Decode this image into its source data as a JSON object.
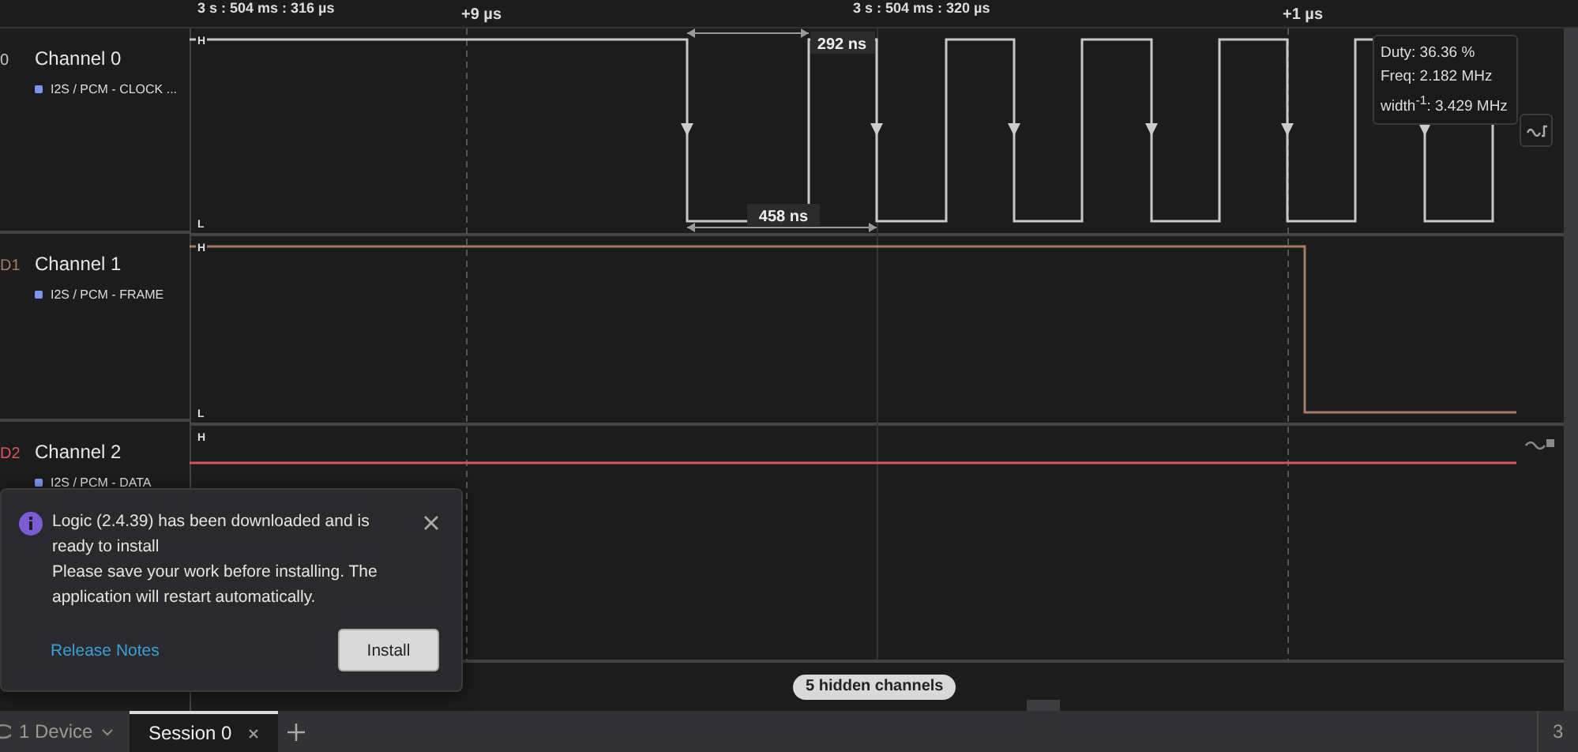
{
  "ruler": {
    "timestamps": [
      "3 s : 504 ms : 316 µs",
      "3 s : 504 ms : 320 µs"
    ],
    "offsets": [
      "+9 µs",
      "+1 µs"
    ]
  },
  "channels": [
    {
      "id": "0",
      "name": "Channel 0",
      "analyzer": "I2S / PCM - CLOCK ...",
      "color": "#c8c8c8",
      "high": "H",
      "low": "L"
    },
    {
      "id": "D1",
      "name": "Channel 1",
      "analyzer": "I2S / PCM - FRAME",
      "color": "#a57a66",
      "high": "H",
      "low": "L"
    },
    {
      "id": "D2",
      "name": "Channel 2",
      "analyzer": "I2S / PCM - DATA",
      "color": "#d9545e",
      "high": "H"
    }
  ],
  "measurements": [
    "292 ns",
    "458 ns"
  ],
  "tooltip": [
    "Duty: 36.36 %",
    "Freq: 2.182 MHz",
    "width$^{-1}$: 3.429 MHz"
  ],
  "hidden_channels": "5 hidden channels",
  "notification": {
    "title": "Logic (2.4.39) has been downloaded and is ready to install",
    "message": "Please save your work before installing. The application will restart automatically.",
    "link": "Release Notes",
    "button": "Install"
  },
  "bottom_bar": {
    "device": "1 Device",
    "tabs": [
      {
        "label": "Session 0",
        "selected": true
      }
    ],
    "zoom": "3"
  }
}
